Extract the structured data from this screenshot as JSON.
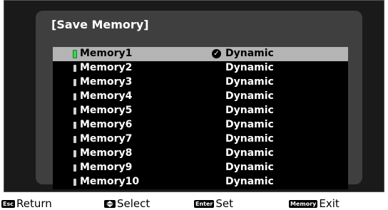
{
  "dialog": {
    "title": "[Save Memory]"
  },
  "memories": [
    {
      "name": "Memory1",
      "mode": "Dynamic",
      "selected": true,
      "check": "✓"
    },
    {
      "name": "Memory2",
      "mode": "Dynamic"
    },
    {
      "name": "Memory3",
      "mode": "Dynamic"
    },
    {
      "name": "Memory4",
      "mode": "Dynamic"
    },
    {
      "name": "Memory5",
      "mode": "Dynamic"
    },
    {
      "name": "Memory6",
      "mode": "Dynamic"
    },
    {
      "name": "Memory7",
      "mode": "Dynamic"
    },
    {
      "name": "Memory8",
      "mode": "Dynamic"
    },
    {
      "name": "Memory9",
      "mode": "Dynamic"
    },
    {
      "name": "Memory10",
      "mode": "Dynamic"
    }
  ],
  "footer": {
    "esc_key": "Esc",
    "return_label": "Return",
    "select_icon": "up-down-arrows-icon",
    "select_label": "Select",
    "enter_key": "Enter",
    "set_label": "Set",
    "memory_key": "Memory",
    "exit_label": "Exit"
  },
  "colors": {
    "selected_marker": "#39d353",
    "selected_row": "#b4b4b4",
    "panel": "#3f3f3f",
    "screen": "#1a1a1a"
  }
}
